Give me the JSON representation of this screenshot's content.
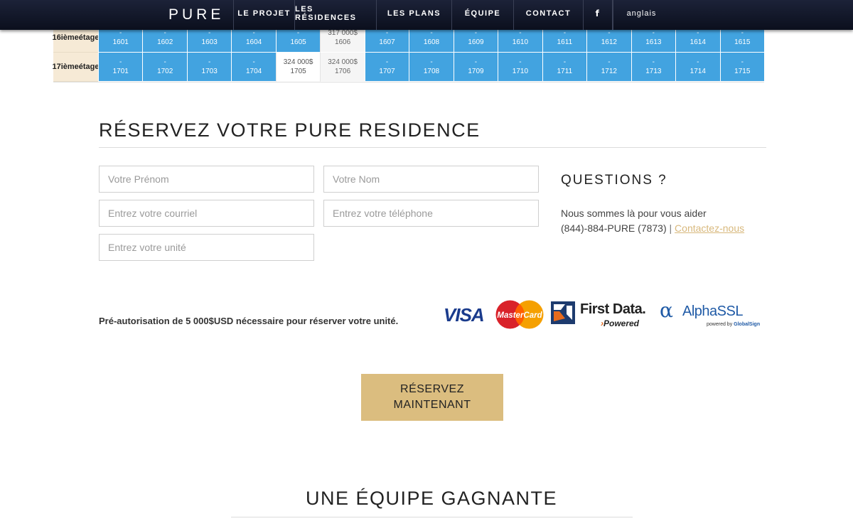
{
  "nav": {
    "brand": "PURE",
    "items": [
      {
        "label": "LE PROJET",
        "name": "nav-item-le-projet"
      },
      {
        "label": "LES RÉSIDENCES",
        "name": "nav-item-les-residences"
      },
      {
        "label": "LES PLANS",
        "name": "nav-item-les-plans"
      },
      {
        "label": "ÉQUIPE",
        "name": "nav-item-equipe"
      },
      {
        "label": "CONTACT",
        "name": "nav-item-contact"
      },
      {
        "label": "f",
        "name": "facebook-icon"
      },
      {
        "label": "anglais",
        "name": "nav-item-anglais"
      }
    ]
  },
  "unit_table": {
    "rows": [
      {
        "floor_line1": "16ième",
        "floor_line2": "étage",
        "units": [
          {
            "price": "-",
            "unit": "1601",
            "status": "unavailable"
          },
          {
            "price": "-",
            "unit": "1602",
            "status": "unavailable"
          },
          {
            "price": "-",
            "unit": "1603",
            "status": "unavailable"
          },
          {
            "price": "-",
            "unit": "1604",
            "status": "unavailable"
          },
          {
            "price": "-",
            "unit": "1605",
            "status": "unavailable"
          },
          {
            "price": "317 000$",
            "unit": "1606",
            "status": "available"
          },
          {
            "price": "-",
            "unit": "1607",
            "status": "unavailable"
          },
          {
            "price": "-",
            "unit": "1608",
            "status": "unavailable"
          },
          {
            "price": "-",
            "unit": "1609",
            "status": "unavailable"
          },
          {
            "price": "-",
            "unit": "1610",
            "status": "unavailable"
          },
          {
            "price": "-",
            "unit": "1611",
            "status": "unavailable"
          },
          {
            "price": "-",
            "unit": "1612",
            "status": "unavailable"
          },
          {
            "price": "-",
            "unit": "1613",
            "status": "unavailable"
          },
          {
            "price": "-",
            "unit": "1614",
            "status": "unavailable"
          },
          {
            "price": "-",
            "unit": "1615",
            "status": "unavailable"
          }
        ]
      },
      {
        "floor_line1": "17ième",
        "floor_line2": "étage",
        "units": [
          {
            "price": "-",
            "unit": "1701",
            "status": "unavailable"
          },
          {
            "price": "-",
            "unit": "1702",
            "status": "unavailable"
          },
          {
            "price": "-",
            "unit": "1703",
            "status": "unavailable"
          },
          {
            "price": "-",
            "unit": "1704",
            "status": "unavailable"
          },
          {
            "price": "324 000$",
            "unit": "1705",
            "status": "selected"
          },
          {
            "price": "324 000$",
            "unit": "1706",
            "status": "available"
          },
          {
            "price": "-",
            "unit": "1707",
            "status": "unavailable"
          },
          {
            "price": "-",
            "unit": "1708",
            "status": "unavailable"
          },
          {
            "price": "-",
            "unit": "1709",
            "status": "unavailable"
          },
          {
            "price": "-",
            "unit": "1710",
            "status": "unavailable"
          },
          {
            "price": "-",
            "unit": "1711",
            "status": "unavailable"
          },
          {
            "price": "-",
            "unit": "1712",
            "status": "unavailable"
          },
          {
            "price": "-",
            "unit": "1713",
            "status": "unavailable"
          },
          {
            "price": "-",
            "unit": "1714",
            "status": "unavailable"
          },
          {
            "price": "-",
            "unit": "1715",
            "status": "unavailable"
          }
        ]
      }
    ]
  },
  "reserve": {
    "title": "RÉSERVEZ VOTRE PURE RESIDENCE",
    "fields": {
      "first_name_placeholder": "Votre Prénom",
      "last_name_placeholder": "Votre Nom",
      "email_placeholder": "Entrez votre courriel",
      "phone_placeholder": "Entrez votre téléphone",
      "unit_placeholder": "Entrez votre unité"
    },
    "preauth": "Pré-autorisation de 5 000$USD nécessaire pour réserver votre unité.",
    "button_line1": "RÉSERVEZ",
    "button_line2": "MAINTENANT"
  },
  "questions": {
    "title": "QUESTIONS ?",
    "help": "Nous sommes là pour vous aider",
    "phone": "(844)-884-PURE (7873)",
    "separator": "|",
    "link": "Contactez-nous"
  },
  "payment_logos": {
    "visa": "VISA",
    "mastercard": "MasterCard",
    "firstdata_name": "First Data.",
    "firstdata_powered": "Powered",
    "alphassl_name": "AlphaSSL",
    "alphassl_sub_prefix": "powered by",
    "alphassl_sub_brand": "GlobalSign"
  },
  "team": {
    "title": "UNE ÉQUIPE GAGNANTE"
  },
  "colors": {
    "nav_bg": "#0f1426",
    "unit_unavailable": "#42a3e0",
    "unit_available": "#f5f5f5",
    "floor_label_bg": "#f6ead6",
    "accent_gold": "#dbbd7f",
    "link_gold": "#d8b87c"
  }
}
